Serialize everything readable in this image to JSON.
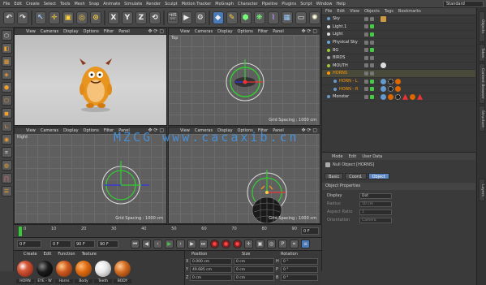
{
  "menubar": {
    "items": [
      "File",
      "Edit",
      "Create",
      "Select",
      "Tools",
      "Mesh",
      "Snap",
      "Animate",
      "Simulate",
      "Render",
      "Sculpt",
      "Motion Tracker",
      "MoGraph",
      "Character",
      "Pipeline",
      "Plugins",
      "Script",
      "Window",
      "Help"
    ],
    "layout_label": "Layout:",
    "layout_value": "Standard"
  },
  "toolbar": {
    "axis_x": "X",
    "axis_y": "Y",
    "axis_z": "Z"
  },
  "viewports": {
    "menu": [
      "View",
      "Cameras",
      "Display",
      "Options",
      "Filter",
      "Panel"
    ],
    "perspective": {
      "label": ""
    },
    "top": {
      "label": "Top",
      "grid_spacing": "Grid Spacing : 1000 cm"
    },
    "right": {
      "label": "Right",
      "grid_spacing": "Grid Spacing : 1000 cm"
    },
    "front": {
      "label": "",
      "grid_spacing": "Grid Spacing : 1000 cm"
    }
  },
  "object_manager": {
    "menu": [
      "File",
      "Edit",
      "View",
      "Objects",
      "Tags",
      "Bookmarks"
    ],
    "objects": [
      {
        "name": "Sky"
      },
      {
        "name": "Light.1"
      },
      {
        "name": "Light"
      },
      {
        "name": "Physical Sky"
      },
      {
        "name": "BG"
      },
      {
        "name": "BIRDS"
      },
      {
        "name": "MOUTH"
      },
      {
        "name": "HORNS"
      },
      {
        "name": "HORN - L"
      },
      {
        "name": "HORN - R"
      },
      {
        "name": "Monster"
      }
    ]
  },
  "side_tabs": [
    "Objects",
    "Takes",
    "Content Browser",
    "Structure",
    "Layers"
  ],
  "attribute_manager": {
    "menu": [
      "Mode",
      "Edit",
      "User Data"
    ],
    "object_title": "Null Object [HORNS]",
    "tabs": [
      "Basic",
      "Coord.",
      "Object"
    ],
    "section": "Object Properties",
    "rows": [
      {
        "label": "Display",
        "value": "Dot"
      },
      {
        "label": "Radius",
        "value": "10 cm"
      },
      {
        "label": "Aspect Ratio",
        "value": "1"
      },
      {
        "label": "Orientation",
        "value": "Camera"
      }
    ]
  },
  "timeline": {
    "ticks": [
      "0",
      "10",
      "20",
      "30",
      "40",
      "50",
      "60",
      "70",
      "80",
      "90"
    ],
    "end_frame": "0 F"
  },
  "playback": {
    "start_field": "0 F",
    "min_field": "0 F",
    "fps_field": "90 F",
    "max_field": "90 F"
  },
  "materials": {
    "menu": [
      "Create",
      "Edit",
      "Function",
      "Texture"
    ],
    "items": [
      {
        "name": "HORN",
        "color": "#b8442a"
      },
      {
        "name": "EYE - W",
        "color": "#1c1c1c"
      },
      {
        "name": "Horns",
        "color": "#d05a20"
      },
      {
        "name": "Body",
        "color": "#e06b10"
      },
      {
        "name": "Teeth",
        "color": "#f0f0f0"
      },
      {
        "name": "BODY",
        "color": "#d36c20"
      }
    ]
  },
  "coordinates": {
    "headers": [
      "Position",
      "Size",
      "Rotation"
    ],
    "rows": [
      {
        "axis": "X",
        "pos": "0.000 cm",
        "size": "0 cm",
        "rot_axis": "H",
        "rot": "0 °"
      },
      {
        "axis": "Y",
        "pos": "49.685 cm",
        "size": "0 cm",
        "rot_axis": "P",
        "rot": "0 °"
      },
      {
        "axis": "Z",
        "pos": "0 cm",
        "size": "0 cm",
        "rot_axis": "B",
        "rot": "0 °"
      }
    ]
  },
  "watermark": "MZCG www.cacaxib.cn"
}
